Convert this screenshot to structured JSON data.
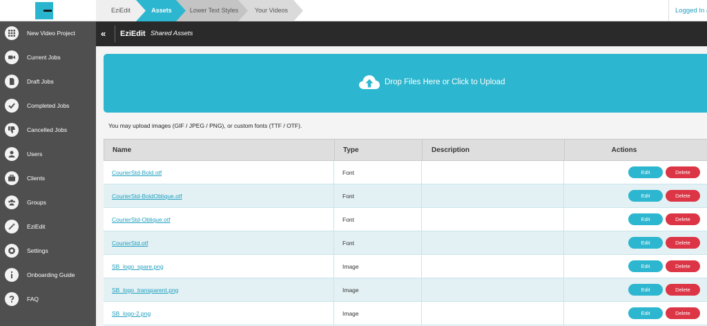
{
  "breadcrumbs": [
    "EziEdit",
    "Assets",
    "Lower Text Styles",
    "Your Videos"
  ],
  "user": {
    "login_text": "Logged In a"
  },
  "sidebar": {
    "items": [
      {
        "label": "New Video Project",
        "icon": "grid-icon"
      },
      {
        "label": "Current Jobs",
        "icon": "video-camera-icon"
      },
      {
        "label": "Draft Jobs",
        "icon": "document-icon"
      },
      {
        "label": "Completed Jobs",
        "icon": "check-icon"
      },
      {
        "label": "Cancelled Jobs",
        "icon": "thumbs-down-icon"
      },
      {
        "label": "Users",
        "icon": "user-icon"
      },
      {
        "label": "Clients",
        "icon": "briefcase-icon"
      },
      {
        "label": "Groups",
        "icon": "users-icon"
      },
      {
        "label": "EziEdit",
        "icon": "magic-wand-icon"
      },
      {
        "label": "Settings",
        "icon": "gear-icon"
      },
      {
        "label": "Onboarding Guide",
        "icon": "info-icon"
      },
      {
        "label": "FAQ",
        "icon": "question-icon"
      }
    ]
  },
  "header": {
    "title": "EziEdit",
    "subtitle": "Shared Assets",
    "collapse_label": "«"
  },
  "upload": {
    "drop_text": "Drop Files Here or Click to Upload",
    "hint": "You may upload images (GIF / JPEG / PNG), or custom fonts (TTF / OTF)."
  },
  "table": {
    "headers": {
      "name": "Name",
      "type": "Type",
      "description": "Description",
      "actions": "Actions"
    },
    "edit_label": "Edit",
    "delete_label": "Delete",
    "rows": [
      {
        "name": "CourierStd-Bold.otf",
        "type": "Font",
        "description": ""
      },
      {
        "name": "CourierStd-BoldOblique.otf",
        "type": "Font",
        "description": ""
      },
      {
        "name": "CourierStd-Oblique.otf",
        "type": "Font",
        "description": ""
      },
      {
        "name": "CourierStd.otf",
        "type": "Font",
        "description": ""
      },
      {
        "name": "SB_logo_spare.png",
        "type": "Image",
        "description": ""
      },
      {
        "name": "SB_logo_transparent.png",
        "type": "Image",
        "description": ""
      },
      {
        "name": "SB_logo-2.png",
        "type": "Image",
        "description": ""
      }
    ]
  },
  "colors": {
    "accent": "#2cb6cf",
    "danger": "#dc3545",
    "sidebar": "#4f4f4f",
    "header": "#2a2a2a"
  }
}
